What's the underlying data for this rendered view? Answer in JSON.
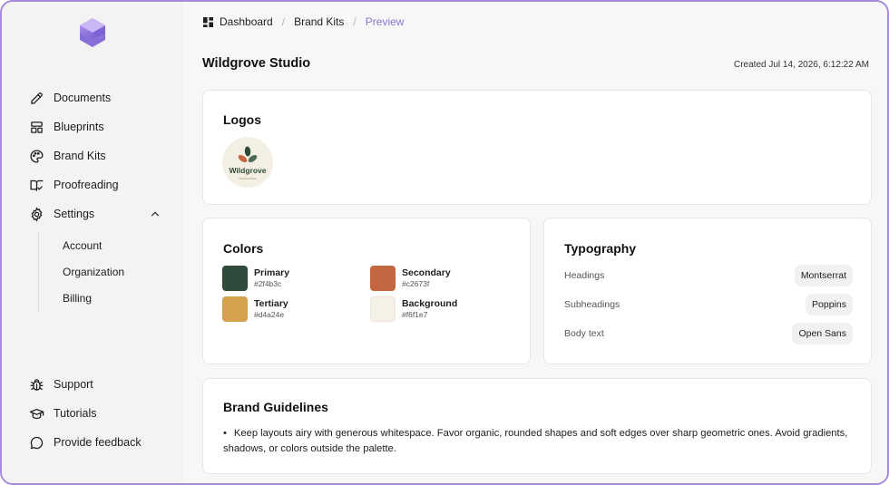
{
  "sidebar": {
    "items": [
      {
        "label": "Documents",
        "icon": "pencil-icon"
      },
      {
        "label": "Blueprints",
        "icon": "layout-icon"
      },
      {
        "label": "Brand Kits",
        "icon": "palette-icon"
      },
      {
        "label": "Proofreading",
        "icon": "book-check-icon"
      },
      {
        "label": "Settings",
        "icon": "gear-icon"
      }
    ],
    "settings_sub": [
      {
        "label": "Account"
      },
      {
        "label": "Organization"
      },
      {
        "label": "Billing"
      }
    ],
    "bottom": [
      {
        "label": "Support",
        "icon": "bug-icon"
      },
      {
        "label": "Tutorials",
        "icon": "graduation-cap-icon"
      },
      {
        "label": "Provide feedback",
        "icon": "chat-bubble-icon"
      }
    ]
  },
  "breadcrumb": {
    "home": "Dashboard",
    "section": "Brand Kits",
    "current": "Preview",
    "separator": "/"
  },
  "page": {
    "title": "Wildgrove Studio",
    "created": "Created Jul 14, 2026, 6:12:22 AM"
  },
  "logos": {
    "title": "Logos",
    "wordmark": "Wildgrove"
  },
  "colors": {
    "title": "Colors",
    "items": [
      {
        "name": "Primary",
        "hex": "#2f4b3c"
      },
      {
        "name": "Secondary",
        "hex": "#c2673f"
      },
      {
        "name": "Tertiary",
        "hex": "#d4a24e"
      },
      {
        "name": "Background",
        "hex": "#f6f1e7"
      }
    ]
  },
  "typography": {
    "title": "Typography",
    "rows": [
      {
        "label": "Headings",
        "font": "Montserrat"
      },
      {
        "label": "Subheadings",
        "font": "Poppins"
      },
      {
        "label": "Body text",
        "font": "Open Sans"
      }
    ]
  },
  "guidelines": {
    "title": "Brand Guidelines",
    "bullet": "•",
    "text": "Keep layouts airy with generous whitespace. Favor organic, rounded shapes and soft edges over sharp geometric ones. Avoid gradients, shadows, or colors outside the palette."
  },
  "theme": {
    "accent": "#8c74d6",
    "frame_border": "#a48ad8"
  }
}
